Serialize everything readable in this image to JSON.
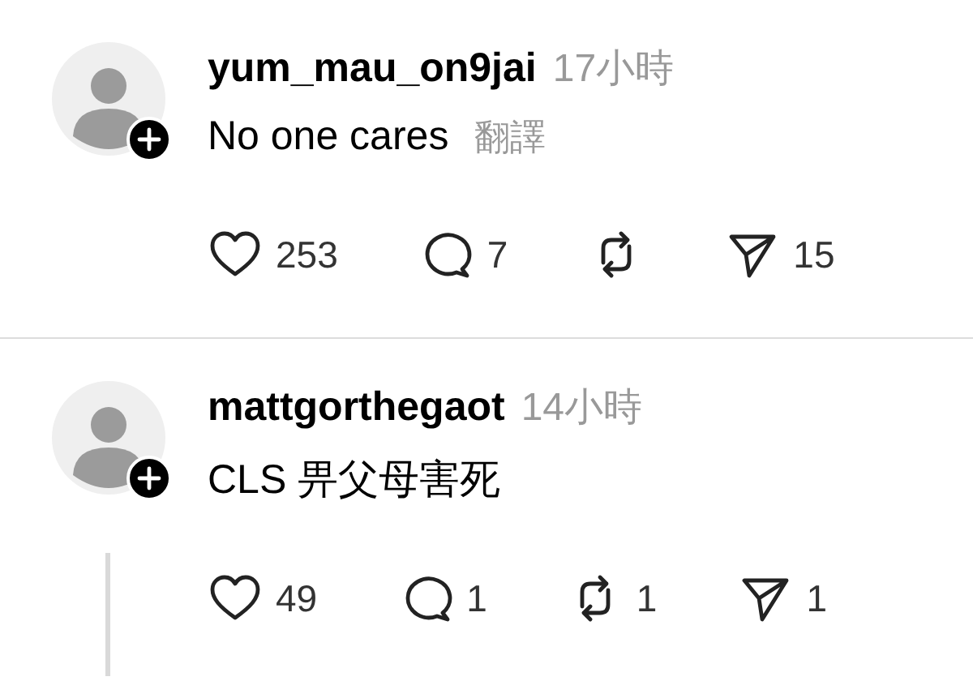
{
  "posts": [
    {
      "username": "yum_mau_on9jai",
      "time": "17小時",
      "text": "No one cares",
      "translate": "翻譯",
      "thread_line": false,
      "actions": [
        {
          "kind": "like",
          "count": "253"
        },
        {
          "kind": "reply",
          "count": "7"
        },
        {
          "kind": "repost"
        },
        {
          "kind": "share",
          "count": "15"
        }
      ]
    },
    {
      "username": "mattgorthegaot",
      "time": "14小時",
      "text": "CLS 畀父母害死",
      "thread_line": true,
      "actions": [
        {
          "kind": "like",
          "count": "49"
        },
        {
          "kind": "reply",
          "count": "1"
        },
        {
          "kind": "repost",
          "count": "1"
        },
        {
          "kind": "share",
          "count": "1"
        }
      ]
    }
  ]
}
